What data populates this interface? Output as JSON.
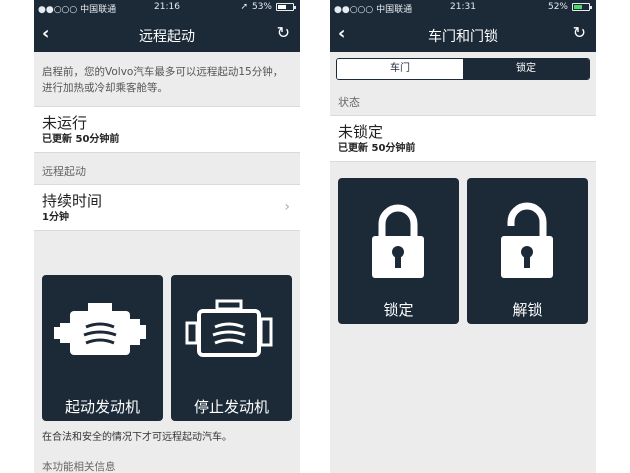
{
  "left": {
    "status": {
      "carrier": "●●○○○ 中国联通 ",
      "time": "21:16",
      "battery": "53%",
      "battery_level": 0.53
    },
    "nav": {
      "title": "远程起动"
    },
    "intro": "启程前，您的Volvo汽车最多可以远程起动15分钟，进行加热或冷却乘客舱等。",
    "status_row": {
      "title": "未运行",
      "updated": "已更新 50分钟前"
    },
    "section_remote": "远程起动",
    "duration_row": {
      "title": "持续时间",
      "value": "1分钟"
    },
    "tiles": {
      "start": "起动发动机",
      "stop": "停止发动机"
    },
    "note": "在合法和安全的情况下才可远程起动汽车。",
    "section_info": "本功能相关信息"
  },
  "right": {
    "status": {
      "carrier": "●●○○○ 中国联通 ",
      "time": "21:31",
      "battery": "52%",
      "battery_level": 0.52
    },
    "nav": {
      "title": "车门和门锁"
    },
    "segment": {
      "door": "车门",
      "lock": "锁定"
    },
    "section_status": "状态",
    "status_row": {
      "title": "未锁定",
      "updated": "已更新 50分钟前"
    },
    "tiles": {
      "lock": "锁定",
      "unlock": "解锁"
    }
  },
  "colors": {
    "navbar": "#1c2a38",
    "tile": "#1c2a38",
    "battery_left": "#ffffff",
    "battery_right": "#4cd964"
  }
}
